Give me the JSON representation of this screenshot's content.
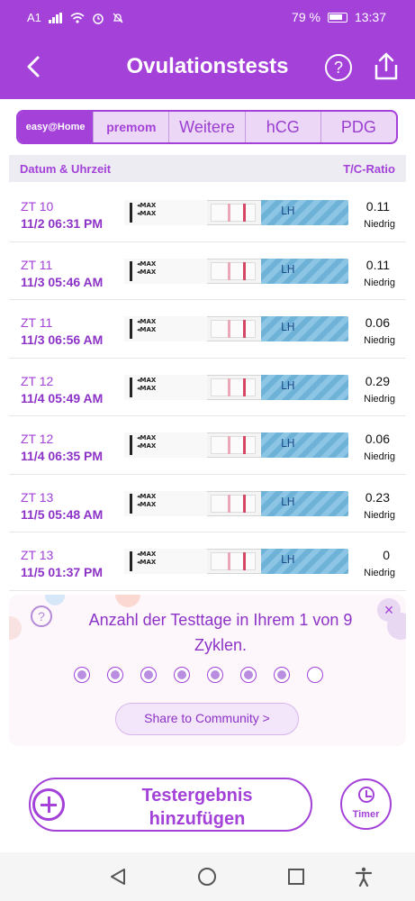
{
  "status": {
    "carrier": "A1",
    "battery": "79 %",
    "time": "13:37"
  },
  "header": {
    "title": "Ovulationstests",
    "help": "?"
  },
  "tabs": [
    {
      "label": "easy@Home",
      "active": true
    },
    {
      "label": "premom"
    },
    {
      "label": "Weitere"
    },
    {
      "label": "hCG"
    },
    {
      "label": "PDG"
    }
  ],
  "table": {
    "col_date": "Datum & Uhrzeit",
    "col_ratio": "T/C-Ratio",
    "strip_text": {
      "max": "MAX",
      "lh": "LH"
    },
    "rows": [
      {
        "zt": "ZT 10",
        "date": "11/2   06:31 PM",
        "ratio": "0.11",
        "level": "Niedrig"
      },
      {
        "zt": "ZT 11",
        "date": "11/3   05:46 AM",
        "ratio": "0.11",
        "level": "Niedrig"
      },
      {
        "zt": "ZT 11",
        "date": "11/3   06:56 AM",
        "ratio": "0.06",
        "level": "Niedrig"
      },
      {
        "zt": "ZT 12",
        "date": "11/4   05:49 AM",
        "ratio": "0.29",
        "level": "Niedrig"
      },
      {
        "zt": "ZT 12",
        "date": "11/4   06:35 PM",
        "ratio": "0.06",
        "level": "Niedrig"
      },
      {
        "zt": "ZT 13",
        "date": "11/5   05:48 AM",
        "ratio": "0.23",
        "level": "Niedrig"
      },
      {
        "zt": "ZT 13",
        "date": "11/5   01:37 PM",
        "ratio": "0",
        "level": "Niedrig"
      }
    ]
  },
  "card": {
    "message": "Anzahl der Testtage in Ihrem 1 von 9 Zyklen.",
    "days_done": 7,
    "days_total": 8,
    "share_label": "Share to Community   >"
  },
  "actions": {
    "add_label": "Testergebnis hinzufügen",
    "timer_label": "Timer"
  },
  "colors": {
    "brand": "#a341d9",
    "tab_bg": "#ecd7f7"
  }
}
